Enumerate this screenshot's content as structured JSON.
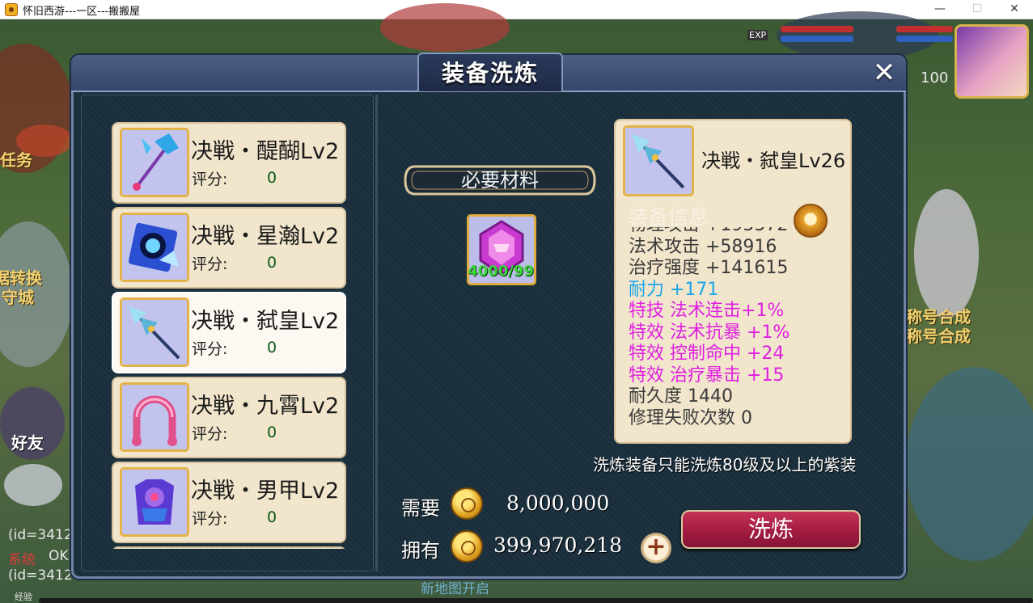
{
  "window": {
    "title": "怀旧西游---一区---搬搬屋",
    "minimize": "—",
    "maximize": "☐",
    "close": "✕"
  },
  "background": {
    "task_label": "任务",
    "left_text_1": "据转换",
    "left_text_2": "守城",
    "friends_label": "好友",
    "chat_line_1": "(id=3412",
    "system_tag": "系统",
    "chat_ok": "OK",
    "chat_line_2": "(id=3412",
    "right_text_1": "称号合成",
    "right_text_2": "称号合成",
    "level_badge": "100",
    "exp_label": "EXP",
    "bottom_text": "新地图开启",
    "exp_bar_label": "经验"
  },
  "dialog": {
    "title": "装备洗炼",
    "close": "✕",
    "equipment_list": [
      {
        "name": "决戦・醍醐Lv2",
        "score_label": "评分:",
        "score": "0",
        "icon": "halberd-icon"
      },
      {
        "name": "决戦・星瀚Lv2",
        "score_label": "评分:",
        "score": "0",
        "icon": "orb-fan-icon"
      },
      {
        "name": "决戦・弑皇Lv2",
        "score_label": "评分:",
        "score": "0",
        "icon": "spear-icon"
      },
      {
        "name": "决戦・九霄Lv2",
        "score_label": "评分:",
        "score": "0",
        "icon": "ribbon-icon"
      },
      {
        "name": "决戦・男甲Lv2",
        "score_label": "评分:",
        "score": "0",
        "icon": "armor-icon"
      }
    ],
    "materials": {
      "label": "必要材料",
      "count": "4000/99",
      "icon": "crystal-icon"
    },
    "detail": {
      "name": "决戦・弑皇Lv26",
      "section": "装备信息",
      "stats": [
        {
          "text": "物理攻击 +195572",
          "color": "#3a3a3a"
        },
        {
          "text": "法术攻击 +58916",
          "color": "#3a3a3a"
        },
        {
          "text": "治疗强度 +141615",
          "color": "#3a3a3a"
        },
        {
          "text": "耐力 +171",
          "color": "#1aa6e8"
        },
        {
          "text": "特技 法术连击+1%",
          "color": "#e020e0"
        },
        {
          "text": "特效 法术抗暴 +1%",
          "color": "#e020e0"
        },
        {
          "text": "特效 控制命中 +24",
          "color": "#e020e0"
        },
        {
          "text": "特效 治疗暴击 +15",
          "color": "#e020e0"
        },
        {
          "text": "耐久度 1440",
          "color": "#3a3a3a"
        },
        {
          "text": "修理失败次数 0",
          "color": "#3a3a3a"
        }
      ]
    },
    "hint": "洗炼装备只能洗炼80级及以上的紫装",
    "cost": {
      "need_label": "需要",
      "need_value": "8,000,000",
      "own_label": "拥有",
      "own_value": "399,970,218",
      "plus": "+"
    },
    "refine_button": "洗炼"
  }
}
